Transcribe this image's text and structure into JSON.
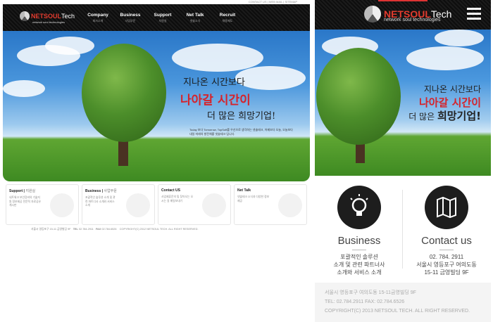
{
  "desktop": {
    "top_links": "CONTACT US  |  WEB MAIL  |  SITEMAP",
    "logo": {
      "net": "NETSOUL",
      "tech": "Tech",
      "sub": "network soul technologies"
    },
    "menu": [
      {
        "en": "Company",
        "ko": "회사소개"
      },
      {
        "en": "Business",
        "ko": "사업부문"
      },
      {
        "en": "Support",
        "ko": "지원실"
      },
      {
        "en": "Net Talk",
        "ko": "넷솔소식"
      },
      {
        "en": "Recruit",
        "ko": "채용제도"
      }
    ],
    "hero": {
      "line1": "지나온 시간보다",
      "line2": "나아갈 시간이",
      "line3": "더 많은 희망기업!",
      "paragraph": "Today 보다 Tomorrow, TopSoft를 우선으로 생각하는 넷솔테크, 어제보다 오늘, 오늘보다 내일 미래의 발전체를 넷솔테크 입니다."
    },
    "cards": [
      {
        "title": "Support",
        "sub": "지원실",
        "desc": "네트워크 보안장비의 기술지원 정보제공 전문적 자료공유 게시판"
      },
      {
        "title": "Business",
        "sub": "사업부문",
        "desc": "포괄적인 솔루션 소개 및 관련 파트너사 소개와 서비스 소개"
      },
      {
        "title": "Contact US",
        "sub": "",
        "desc": "사업제휴문의 및 찾아오는 오시는 길 매일보내기"
      },
      {
        "title": "Net Talk",
        "sub": "",
        "desc": "넷솔테크 소식과 다양한 정보 제공"
      }
    ],
    "footer": {
      "address": "서울시 영등포구 15-11 금영빌딩 9F",
      "tel_label": "TEL",
      "tel": "02.784.2911",
      "fax_label": "FAX",
      "fax": "02.784.6526",
      "copyright": "COPYRIGHT(C) 2012 NETSOUL TECH. ALL RIGHT RESERVED."
    }
  },
  "mobile": {
    "logo": {
      "net": "NETSOUL",
      "tech": "Tech",
      "sub": "network soul technologies"
    },
    "hero": {
      "line1": "지나온 시간보다",
      "line2": "나아갈 시간이",
      "line3_prefix": "더 많은 ",
      "line3_bold": "희망기업!"
    },
    "services": [
      {
        "title": "Business",
        "desc": [
          "포괄적인 솔루션",
          "소개 및 관련 파트너사",
          "소개와 서비스 소개"
        ],
        "icon": "lightbulb-icon"
      },
      {
        "title": "Contact us",
        "desc": [
          "02. 784. 2911",
          "서울시 영등포구 여의도동",
          "15-11 금영빌딩 9F"
        ],
        "icon": "map-icon"
      }
    ],
    "footer": {
      "address": "서울시 영등포구 여의도동 15-11금영빌딩 9F",
      "tel_fax": "TEL: 02.784.2911   FAX: 02.784.6526",
      "copyright": "COPYRIGHT(C) 2013 NETSOUL TECH. ALL RIGHT RESERVED."
    }
  },
  "colors": {
    "brand_red": "#e23b2e",
    "hero_red": "#d5232b",
    "nav_dark": "#101010"
  }
}
